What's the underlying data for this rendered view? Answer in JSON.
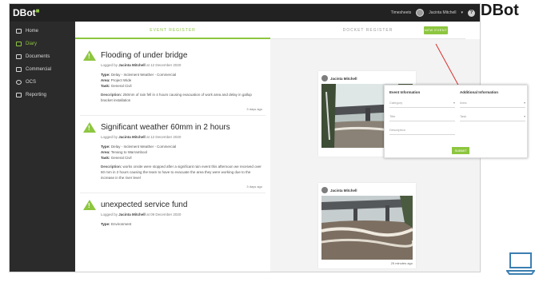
{
  "corner": {
    "brand": "DBot"
  },
  "app": {
    "logo": "DBot",
    "user_name": "Jacinta Mitchell",
    "topbar_link": "Timesheets",
    "help": "?"
  },
  "sidebar": {
    "items": [
      {
        "label": "Home"
      },
      {
        "label": "Diary"
      },
      {
        "label": "Documents"
      },
      {
        "label": "Commercial"
      },
      {
        "label": "OCS"
      },
      {
        "label": "Reporting"
      }
    ]
  },
  "tabs": [
    {
      "label": "EVENT REGISTER"
    },
    {
      "label": "DOCKET REGISTER"
    }
  ],
  "events": [
    {
      "title": "Flooding of under bridge",
      "logged_prefix": "Logged by",
      "logged_by": "Jacinta Mitchell",
      "logged_date": "at 12 December 2020",
      "type_label": "Type:",
      "type": "Delay - Inclement Weather - Commercial",
      "area_label": "Area:",
      "area": "Project Wide",
      "task_label": "Task:",
      "task": "General Civil",
      "desc_label": "Description:",
      "desc": "250mm of rain fell in 4 hours causing evacuation of work area and delay in gallup bracket installation",
      "ago": "3 days ago"
    },
    {
      "title": "Significant weather 60mm in 2 hours",
      "logged_prefix": "Logged by",
      "logged_by": "Jacinta Mitchell",
      "logged_date": "at 12 December 2020",
      "type_label": "Type:",
      "type": "Delay - Inclement Weather - Commercial",
      "area_label": "Area:",
      "area": "Tenang to Warrambool",
      "task_label": "Task:",
      "task": "General Civil",
      "desc_label": "Description:",
      "desc": "works onsite were stopped after a significant rain event this afternoon we received over 60 mm in 2 hours causing the team to have to evacuate the area they were working due to the increase in the river level",
      "ago": "3 days ago"
    },
    {
      "title": "unexpected service fund",
      "logged_prefix": "Logged by",
      "logged_by": "Jacinta Mitchell",
      "logged_date": "at 09 December 2020",
      "type_label": "Type:",
      "type": "Environment"
    }
  ],
  "new_event_button": "NEW EVENT",
  "cards": [
    {
      "author": "Jacinta Mitchell",
      "ago": "3 days ago"
    },
    {
      "author": "Jacinta Mitchell",
      "ago": "25 minutes ago"
    }
  ],
  "popup": {
    "left_heading": "Event Information",
    "right_heading": "Additional Information",
    "fields_left": [
      "Category",
      "Title",
      "Description"
    ],
    "fields_right": [
      "Area",
      "Task"
    ],
    "submit": "SUBMIT"
  },
  "colors": {
    "accent": "#8dc63f",
    "topbar": "#222222",
    "sidebar": "#2b2b2b",
    "annotation": "#d9302c"
  }
}
